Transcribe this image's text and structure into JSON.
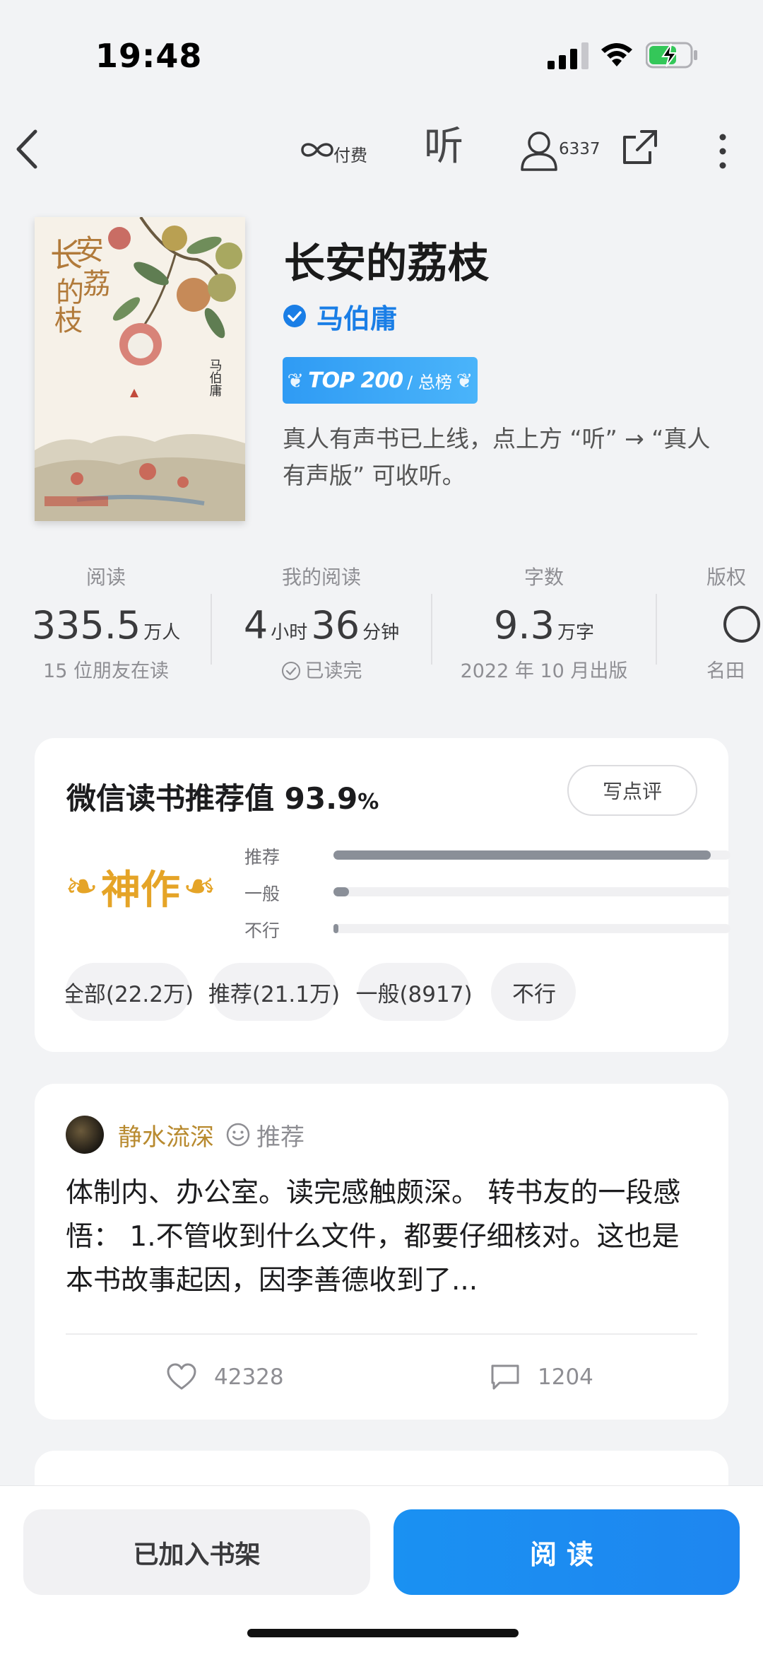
{
  "status": {
    "time": "19:48"
  },
  "nav": {
    "paid_label": "付费",
    "listen_label": "听",
    "reader_count": "6337"
  },
  "book": {
    "title": "长安的荔枝",
    "author": "马伯庸",
    "rank_badge": {
      "main": "TOP 200",
      "sub": "/ 总榜"
    },
    "note": "真人有声书已上线，点上方 “听” → “真人有声版” 可收听。",
    "cover": {
      "title_chars": "长安的荔枝",
      "author": "马伯庸"
    }
  },
  "stats": {
    "reads": {
      "label": "阅读",
      "value": "335.5",
      "unit": "万人",
      "sub": "15 位朋友在读"
    },
    "my_reading": {
      "label": "我的阅读",
      "hours": "4",
      "hours_unit": "小时",
      "minutes": "36",
      "minutes_unit": "分钟",
      "sub": "已读完"
    },
    "words": {
      "label": "字数",
      "value": "9.3",
      "unit": "万字",
      "sub": "2022 年 10 月出版"
    },
    "rights": {
      "label": "版权",
      "sub": "名田"
    }
  },
  "rating": {
    "title": "微信读书推荐值 93.9",
    "percent_sign": "%",
    "write_label": "写点评",
    "badge": "神作",
    "bars": [
      {
        "label": "推荐",
        "fraction": 0.95
      },
      {
        "label": "一般",
        "fraction": 0.04
      },
      {
        "label": "不行",
        "fraction": 0.01
      }
    ],
    "filters": [
      "全部(22.2万)",
      "推荐(21.1万)",
      "一般(8917)",
      "不行"
    ]
  },
  "review": {
    "user": "静水流深",
    "tag": "推荐",
    "body": "体制内、办公室。读完感触颇深。 转书友的一段感悟： 1.不管收到什么文件，都要仔细核对。这也是本书故事起因，因李善德收到了...",
    "likes": "42328",
    "comments": "1204"
  },
  "bottom": {
    "shelf_label": "已加入书架",
    "read_label": "阅读"
  },
  "colors": {
    "accent": "#1a91f2",
    "author_blue": "#1a7ee6",
    "gold": "#e5a427",
    "background": "#f2f3f5"
  }
}
